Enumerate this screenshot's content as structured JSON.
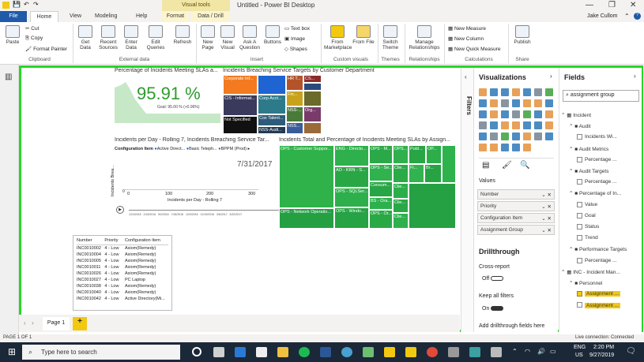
{
  "app": {
    "title": "Untitled - Power BI Desktop",
    "context_tab_group": "Visual tools",
    "user": "Jake Cullom"
  },
  "tabs": [
    {
      "label": "File"
    },
    {
      "label": "Home"
    },
    {
      "label": "View"
    },
    {
      "label": "Modeling"
    },
    {
      "label": "Help"
    },
    {
      "label": "Format"
    },
    {
      "label": "Data / Drill"
    }
  ],
  "ribbon": {
    "clipboard": {
      "paste": "Paste",
      "cut": "Cut",
      "copy": "Copy",
      "format_painter": "Format Painter",
      "group": "Clipboard"
    },
    "external": {
      "get_data": "Get Data",
      "recent": "Recent Sources",
      "enter": "Enter Data",
      "edit": "Edit Queries",
      "refresh": "Refresh",
      "group": "External data"
    },
    "insert": {
      "new_page": "New Page",
      "new_visual": "New Visual",
      "ask": "Ask A Question",
      "buttons": "Buttons",
      "textbox": "Text box",
      "image": "Image",
      "shapes": "Shapes",
      "group": "Insert"
    },
    "custom": {
      "marketplace": "From Marketplace",
      "file": "From File",
      "group": "Custom visuals"
    },
    "themes": {
      "switch": "Switch Theme",
      "group": "Themes"
    },
    "relationships": {
      "manage": "Manage Relationships",
      "group": "Relationships"
    },
    "calc": {
      "measure": "New Measure",
      "column": "New Column",
      "quick": "New Quick Measure",
      "group": "Calculations"
    },
    "share": {
      "publish": "Publish",
      "group": "Share"
    }
  },
  "visuals": {
    "kpi": {
      "title": "Percentage of Incidents Meeting SLAs a...",
      "value": "95.91 %",
      "goal": "Goal: 95.00 % (+0.96%)"
    },
    "treemap1": {
      "title": "Incidents Breaching Service Targets by Customer Department",
      "cells": [
        "Corporate Inf...",
        "CIS - Informat...",
        "Corp Acct...",
        "Not Specified",
        "Cox Talent...",
        "NSS-Audi...",
        "NSS-...",
        "HR T...",
        "CS...",
        "Fin...",
        "Org...",
        "NSS..."
      ]
    },
    "line": {
      "title": "Incidents per Day - Rolling 7, Incidents Breaching Service Tar...",
      "legend_label": "Configuration Item",
      "legend": [
        "Active Direct...",
        "Basic Teleph...",
        "BPPM (Prod)"
      ],
      "date": "7/31/2017",
      "y_label": "Incidents Brea...",
      "x_label": "Incidents per Day - Rolling 7",
      "x_ticks": [
        "0",
        "100",
        "200",
        "300"
      ],
      "y_ticks": [
        "0"
      ],
      "dates": [
        "12/4/2015",
        "2/15/2016",
        "5/2/2016",
        "7/18/2016",
        "10/3/2016",
        "12/19/2016",
        "3/6/2017",
        "5/22/2017"
      ]
    },
    "treemap2": {
      "title": "Incidents Total and Percentage of Incidents Meeting SLAs by Assign...",
      "cells": [
        "OPS - Customer Suppor...",
        "ENG - Directo...",
        "OPS - M...",
        "OPS...",
        "Publ...",
        "OP...",
        "AO - KRN - S...",
        "OPS - Se...",
        "Clie...",
        "Fi...",
        "Br...",
        "OPS - SQLSer...",
        "Consum...",
        "Clie...",
        "BS - Ora...",
        "OPS - Network Operatio...",
        "OPS - Windo...",
        "OPS - Or...",
        "Clie...",
        "Clie..."
      ]
    },
    "table": {
      "headers": [
        "Number",
        "Priority",
        "Configuration Item"
      ],
      "rows": [
        [
          "INC0010002",
          "4 - Low",
          "Axiom(Remedy)"
        ],
        [
          "INC0010004",
          "4 - Low",
          "Axiom(Remedy)"
        ],
        [
          "INC0010005",
          "4 - Low",
          "Axiom(Remedy)"
        ],
        [
          "INC0010011",
          "4 - Low",
          "Axiom(Remedy)"
        ],
        [
          "INC0010026",
          "4 - Low",
          "Axiom(Remedy)"
        ],
        [
          "INC0010027",
          "4 - Low",
          "PC Laptop"
        ],
        [
          "INC0010038",
          "4 - Low",
          "Axiom(Remedy)"
        ],
        [
          "INC0010040",
          "4 - Low",
          "Axiom(Remedy)"
        ],
        [
          "INC0010042",
          "4 - Low",
          "Active Directory(Mi..."
        ]
      ]
    }
  },
  "pages": {
    "tab": "Page 1",
    "add": "+"
  },
  "visualizations": {
    "title": "Visualizations",
    "values_label": "Values",
    "wells": [
      "Number",
      "Priority",
      "Configuration Item",
      "Assignment Group"
    ],
    "drill_title": "Drillthrough",
    "cross_report": "Cross-report",
    "off": "Off",
    "keep_filters": "Keep all filters",
    "on": "On",
    "add_fields": "Add drillthrough fields here"
  },
  "filters_label": "Filters",
  "fields": {
    "title": "Fields",
    "search_value": "assignment group",
    "tree": [
      {
        "label": "Incident",
        "level": 0,
        "type": "table"
      },
      {
        "label": "Audit",
        "level": 1,
        "type": "folder"
      },
      {
        "label": "Incidents Wi...",
        "level": 2,
        "type": "field"
      },
      {
        "label": "Audit Metrics",
        "level": 1,
        "type": "folder"
      },
      {
        "label": "Percentage ...",
        "level": 2,
        "type": "field"
      },
      {
        "label": "Audit Targets",
        "level": 1,
        "type": "folder"
      },
      {
        "label": "Percentage ...",
        "level": 2,
        "type": "field"
      },
      {
        "label": "Percentage of In...",
        "level": 1,
        "type": "kpi"
      },
      {
        "label": "Value",
        "level": 2,
        "type": "field"
      },
      {
        "label": "Goal",
        "level": 2,
        "type": "field"
      },
      {
        "label": "Status",
        "level": 2,
        "type": "field"
      },
      {
        "label": "Trend",
        "level": 2,
        "type": "field"
      },
      {
        "label": "Performance Targets",
        "level": 1,
        "type": "folder"
      },
      {
        "label": "Percentage ...",
        "level": 2,
        "type": "field"
      },
      {
        "label": "INC - Incident Man...",
        "level": 0,
        "type": "table"
      },
      {
        "label": "Personnel",
        "level": 1,
        "type": "folder"
      },
      {
        "label": "Assignment ...",
        "level": 2,
        "type": "field",
        "checked": true,
        "highlight": true
      },
      {
        "label": "Assignment ...",
        "level": 2,
        "type": "field",
        "checked": false,
        "highlight": true
      }
    ]
  },
  "status": {
    "page": "PAGE 1 OF 1",
    "connection": "Live connection: Connected"
  },
  "taskbar": {
    "search": "Type here to search",
    "lang1": "ENG",
    "lang2": "US",
    "time": "2:20 PM",
    "date": "9/27/2019"
  },
  "colors": {
    "accent": "#f2c811",
    "file_tab": "#1f5ba8",
    "frame": "#27d627"
  }
}
